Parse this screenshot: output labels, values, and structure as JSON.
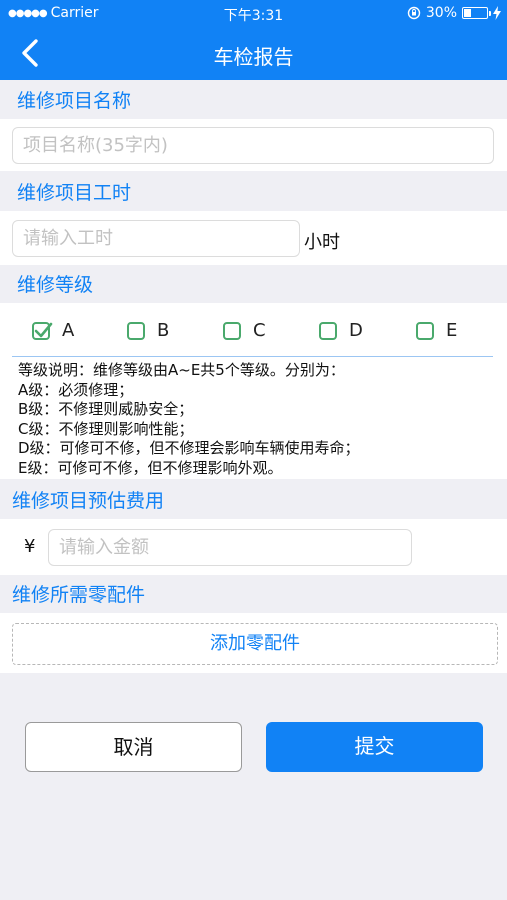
{
  "status_bar": {
    "carrier": "Carrier",
    "time": "下午3:31",
    "battery_percent": "30%",
    "battery_level": 0.3
  },
  "nav": {
    "title": "车检报告",
    "back_icon": "chevron-left-icon"
  },
  "sections": {
    "name": {
      "header": "维修项目名称",
      "placeholder": "项目名称(35字内)"
    },
    "hours": {
      "header": "维修项目工时",
      "placeholder": "请输入工时",
      "unit": "小时"
    },
    "grade": {
      "header": "维修等级",
      "options": [
        {
          "label": "A",
          "checked": true
        },
        {
          "label": "B",
          "checked": false
        },
        {
          "label": "C",
          "checked": false
        },
        {
          "label": "D",
          "checked": false
        },
        {
          "label": "E",
          "checked": false
        }
      ],
      "description": [
        "等级说明：维修等级由A~E共5个等级。分别为：",
        "A级：必须修理；",
        "B级：不修理则威胁安全；",
        "C级：不修理则影响性能；",
        "D级：可修可不修，但不修理会影响车辆使用寿命；",
        "E级：可修可不修，但不修理影响外观。"
      ]
    },
    "cost": {
      "header": "维修项目预估费用",
      "currency": "¥",
      "placeholder": "请输入金额"
    },
    "parts": {
      "header": "维修所需零配件",
      "add_label": "添加零配件"
    }
  },
  "actions": {
    "cancel": "取消",
    "submit": "提交"
  },
  "colors": {
    "primary": "#1182f5",
    "check": "#4aa96c"
  }
}
